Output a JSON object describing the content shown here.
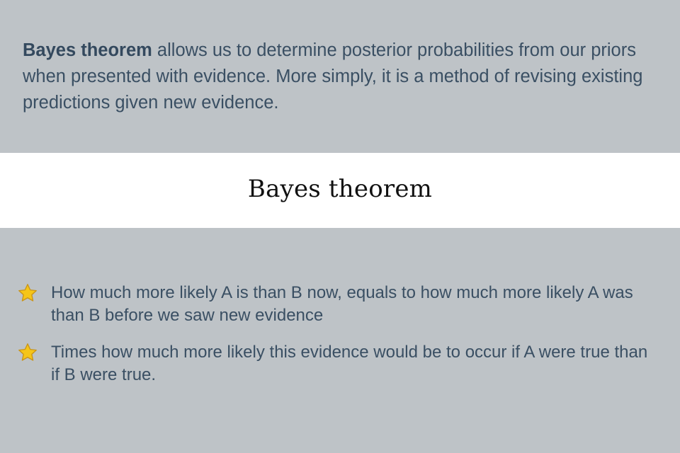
{
  "intro": {
    "term": "Bayes theorem",
    "text": " allows us to determine posterior probabilities from our priors when presented with evidence. More simply, it is a method of revising existing predictions given new evidence."
  },
  "banner": {
    "title": "Bayes theorem"
  },
  "points": [
    {
      "icon": "star-icon",
      "text": "How much more likely A is than B now, equals to how much more likely A was than B before we saw new evidence"
    },
    {
      "icon": "star-icon",
      "text": "Times how much more likely this evidence would be to occur if A were true than if B were true."
    }
  ],
  "colors": {
    "background": "#bec3c7",
    "text": "#3a4f63",
    "banner": "#ffffff",
    "star": "#f5c518"
  }
}
